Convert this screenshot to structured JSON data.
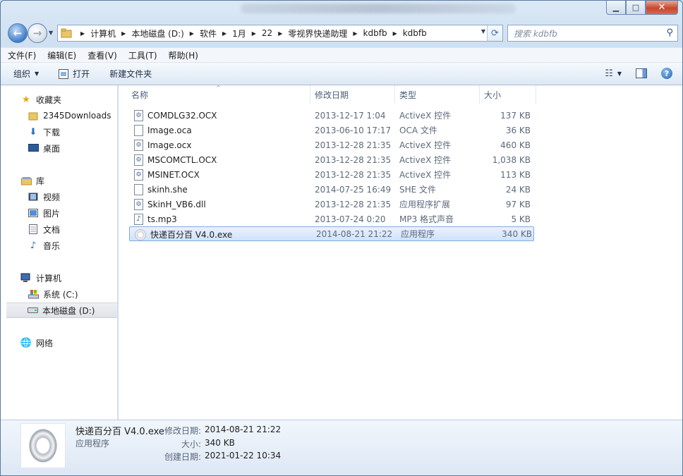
{
  "titlebar": {
    "minimize": "▁",
    "maximize": "□",
    "close": "✕"
  },
  "address": {
    "crumbs": [
      "计算机",
      "本地磁盘 (D:)",
      "软件",
      "1月",
      "22",
      "零视界快递助理",
      "kdbfb",
      "kdbfb"
    ]
  },
  "search": {
    "placeholder": "搜索 kdbfb"
  },
  "menu": [
    "文件(F)",
    "编辑(E)",
    "查看(V)",
    "工具(T)",
    "帮助(H)"
  ],
  "toolbar": {
    "organize": "组织",
    "open": "打开",
    "new_folder": "新建文件夹"
  },
  "nav": {
    "favorites": "收藏夹",
    "fav_items": [
      "2345Downloads",
      "下载",
      "桌面"
    ],
    "libraries": "库",
    "lib_items": [
      "视频",
      "图片",
      "文档",
      "音乐"
    ],
    "computer": "计算机",
    "drives": [
      "系统 (C:)",
      "本地磁盘 (D:)"
    ],
    "network": "网络"
  },
  "columns": {
    "name": "名称",
    "date": "修改日期",
    "type": "类型",
    "size": "大小"
  },
  "files": [
    {
      "name": "COMDLG32.OCX",
      "date": "2013-12-17 1:04",
      "type": "ActiveX 控件",
      "size": "137 KB",
      "icon": "gear"
    },
    {
      "name": "Image.oca",
      "date": "2013-06-10 17:17",
      "type": "OCA 文件",
      "size": "36 KB",
      "icon": "blank"
    },
    {
      "name": "Image.ocx",
      "date": "2013-12-28 21:35",
      "type": "ActiveX 控件",
      "size": "460 KB",
      "icon": "gear"
    },
    {
      "name": "MSCOMCTL.OCX",
      "date": "2013-12-28 21:35",
      "type": "ActiveX 控件",
      "size": "1,038 KB",
      "icon": "gear"
    },
    {
      "name": "MSINET.OCX",
      "date": "2013-12-28 21:35",
      "type": "ActiveX 控件",
      "size": "113 KB",
      "icon": "gear"
    },
    {
      "name": "skinh.she",
      "date": "2014-07-25 16:49",
      "type": "SHE 文件",
      "size": "24 KB",
      "icon": "blank"
    },
    {
      "name": "SkinH_VB6.dll",
      "date": "2013-12-28 21:35",
      "type": "应用程序扩展",
      "size": "97 KB",
      "icon": "gear"
    },
    {
      "name": "ts.mp3",
      "date": "2013-07-24 0:20",
      "type": "MP3 格式声音",
      "size": "5 KB",
      "icon": "music"
    },
    {
      "name": "快递百分百 V4.0.exe",
      "date": "2014-08-21 21:22",
      "type": "应用程序",
      "size": "340 KB",
      "icon": "exe"
    }
  ],
  "details": {
    "filename": "快递百分百 V4.0.exe",
    "filetype": "应用程序",
    "modified_label": "修改日期:",
    "modified": "2014-08-21 21:22",
    "size_label": "大小:",
    "size": "340 KB",
    "created_label": "创建日期:",
    "created": "2021-01-22 10:34"
  }
}
